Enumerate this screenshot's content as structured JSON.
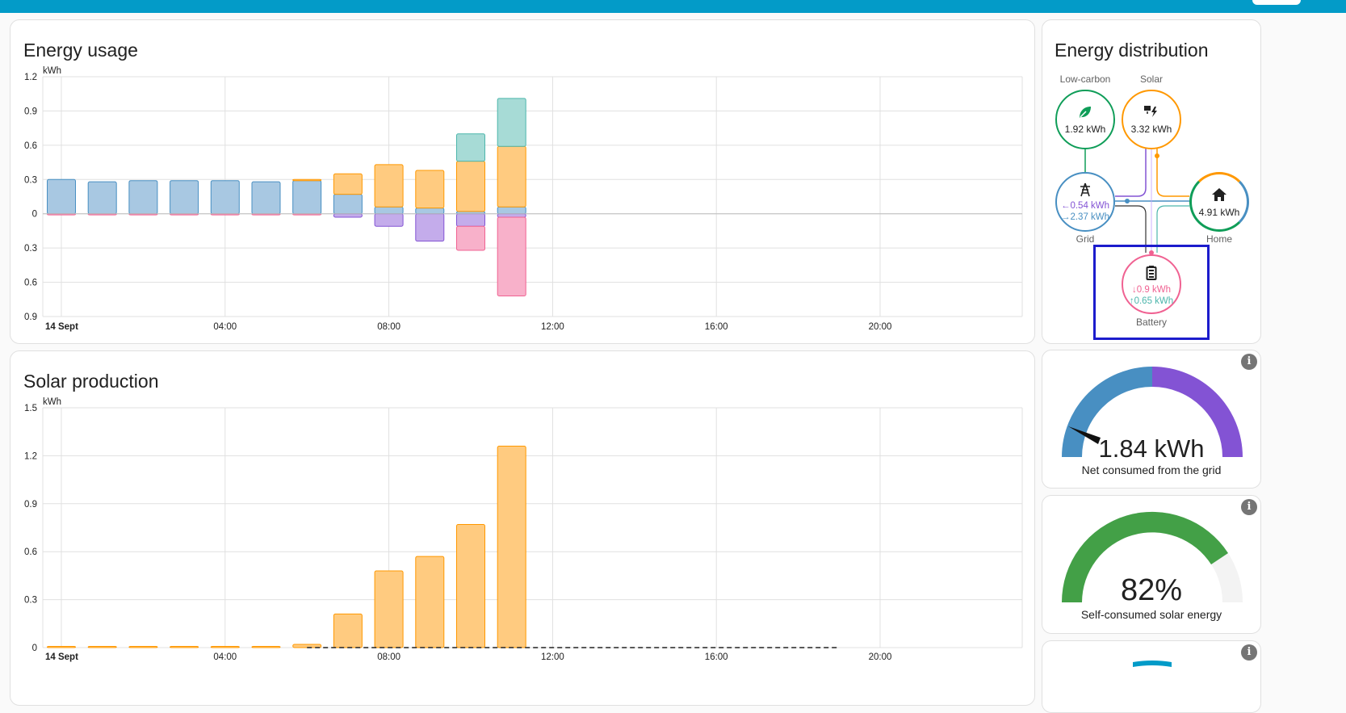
{
  "colors": {
    "topbar": "#039bc8",
    "grid": "#488fc2",
    "solar": "#ff9800",
    "solar_fill": "#ffcb80",
    "battery_out": "#4db6ac",
    "battery_in": "#f06292",
    "grid_return": "#8353d4",
    "low_carbon": "#0f9d58",
    "gauge_green": "#43a047",
    "highlight": "#1c1ccc"
  },
  "energy_usage": {
    "title": "Energy usage",
    "unit": "kWh",
    "y_ticks": [
      "1.2",
      "0.9",
      "0.6",
      "0.3",
      "0",
      "0.3",
      "0.6",
      "0.9"
    ],
    "x_ticks": [
      "14 Sept",
      "04:00",
      "08:00",
      "12:00",
      "16:00",
      "20:00"
    ]
  },
  "solar_production": {
    "title": "Solar production",
    "unit": "kWh",
    "y_ticks": [
      "1.5",
      "1.2",
      "0.9",
      "0.6",
      "0.3",
      "0"
    ],
    "x_ticks": [
      "14 Sept",
      "04:00",
      "08:00",
      "12:00",
      "16:00",
      "20:00"
    ]
  },
  "chart_data": [
    {
      "type": "bar",
      "title": "Energy usage",
      "ylabel": "kWh",
      "ylim": [
        -0.9,
        1.2
      ],
      "categories": [
        "00:00",
        "01:00",
        "02:00",
        "03:00",
        "04:00",
        "05:00",
        "06:00",
        "07:00",
        "08:00",
        "09:00",
        "10:00",
        "11:00"
      ],
      "series": [
        {
          "name": "grid",
          "stack": "positive",
          "values": [
            0.3,
            0.28,
            0.29,
            0.29,
            0.29,
            0.28,
            0.29,
            0.17,
            0.06,
            0.05,
            0.02,
            0.06
          ]
        },
        {
          "name": "solar",
          "stack": "positive",
          "values": [
            0,
            0,
            0,
            0,
            0,
            0,
            0.01,
            0.18,
            0.37,
            0.33,
            0.44,
            0.53
          ]
        },
        {
          "name": "battery_out",
          "stack": "positive",
          "values": [
            0,
            0,
            0,
            0,
            0,
            0,
            0,
            0,
            0,
            0,
            0.24,
            0.42
          ]
        },
        {
          "name": "grid_return",
          "stack": "negative",
          "values": [
            0,
            0,
            0,
            0,
            0,
            0,
            0,
            -0.03,
            -0.11,
            -0.24,
            -0.11,
            -0.03
          ]
        },
        {
          "name": "battery_in",
          "stack": "negative",
          "values": [
            -0.01,
            -0.01,
            -0.01,
            -0.01,
            -0.01,
            -0.01,
            -0.01,
            0,
            0,
            0,
            -0.21,
            -0.69
          ]
        }
      ],
      "grid": true
    },
    {
      "type": "bar",
      "title": "Solar production",
      "ylabel": "kWh",
      "ylim": [
        0,
        1.5
      ],
      "categories": [
        "00:00",
        "01:00",
        "02:00",
        "03:00",
        "04:00",
        "05:00",
        "06:00",
        "07:00",
        "08:00",
        "09:00",
        "10:00",
        "11:00"
      ],
      "series": [
        {
          "name": "solar",
          "values": [
            0.005,
            0.005,
            0.005,
            0.005,
            0.005,
            0.005,
            0.02,
            0.21,
            0.48,
            0.57,
            0.77,
            1.26
          ]
        }
      ],
      "forecast_line": {
        "from": "06:00",
        "to": "19:00",
        "value": 0
      },
      "grid": true
    }
  ],
  "distribution": {
    "title": "Energy distribution",
    "low_carbon": {
      "label": "Low-carbon",
      "value": "1.92 kWh"
    },
    "solar": {
      "label": "Solar",
      "value": "3.32 kWh"
    },
    "grid": {
      "label": "Grid",
      "in": "0.54 kWh",
      "out": "2.37 kWh",
      "in_arrow": "←",
      "out_arrow": "→"
    },
    "home": {
      "label": "Home",
      "value": "4.91 kWh"
    },
    "battery": {
      "label": "Battery",
      "in": "0.9 kWh",
      "out": "0.65 kWh",
      "in_arrow": "↓",
      "out_arrow": "↑"
    },
    "icons": {
      "low_carbon": "leaf-icon",
      "solar": "solar-power-icon",
      "grid": "transmission-tower-icon",
      "home": "home-icon",
      "battery": "battery-icon"
    }
  },
  "gauge_grid": {
    "value": "1.84 kWh",
    "label": "Net consumed from the grid",
    "needle_fraction": 0.12
  },
  "gauge_solar": {
    "value": "82%",
    "label": "Self-consumed solar energy",
    "fraction": 0.82
  },
  "info_icon_glyph": "i"
}
